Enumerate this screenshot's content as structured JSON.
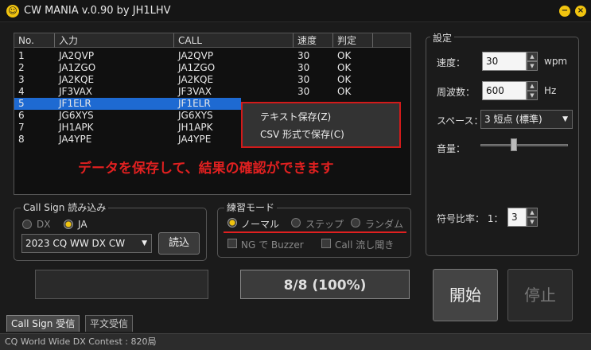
{
  "window": {
    "title": "CW MANIA v.0.90 by JH1LHV"
  },
  "list": {
    "columns": [
      "No.",
      "入力",
      "CALL",
      "速度",
      "判定"
    ],
    "rows": [
      {
        "no": "1",
        "input": "JA2QVP",
        "call": "JA2QVP",
        "speed": "30",
        "result": "OK"
      },
      {
        "no": "2",
        "input": "JA1ZGO",
        "call": "JA1ZGO",
        "speed": "30",
        "result": "OK"
      },
      {
        "no": "3",
        "input": "JA2KQE",
        "call": "JA2KQE",
        "speed": "30",
        "result": "OK"
      },
      {
        "no": "4",
        "input": "JF3VAX",
        "call": "JF3VAX",
        "speed": "30",
        "result": "OK"
      },
      {
        "no": "5",
        "input": "JF1ELR",
        "call": "JF1ELR",
        "speed": "",
        "result": ""
      },
      {
        "no": "6",
        "input": "JG6XYS",
        "call": "JG6XYS",
        "speed": "",
        "result": ""
      },
      {
        "no": "7",
        "input": "JH1APK",
        "call": "JH1APK",
        "speed": "",
        "result": ""
      },
      {
        "no": "8",
        "input": "JA4YPE",
        "call": "JA4YPE",
        "speed": "",
        "result": ""
      }
    ]
  },
  "context_menu": {
    "items": [
      "テキスト保存(Z)",
      "CSV 形式で保存(C)"
    ]
  },
  "annotation": "データを保存して、結果の確認ができます",
  "callsign": {
    "title": "Call Sign 読み込み",
    "radio": [
      "DX",
      "JA"
    ],
    "selected": "JA",
    "contest": "2023 CQ WW DX CW",
    "load_button": "読込"
  },
  "practice": {
    "title": "練習モード",
    "modes": [
      "ノーマル",
      "ステップ",
      "ランダム"
    ],
    "selected": "ノーマル",
    "checks": [
      "NG で Buzzer",
      "Call 流し聞き"
    ]
  },
  "progress": {
    "text": "8/8 (100%)",
    "fraction": 1.0
  },
  "tabs": [
    "Call Sign 受信",
    "平文受信"
  ],
  "status": "CQ World Wide DX Contest : 820局",
  "settings": {
    "title": "設定",
    "speed_label": "速度：",
    "speed_value": "30",
    "speed_unit": "wpm",
    "freq_label": "周波数：",
    "freq_value": "600",
    "freq_unit": "Hz",
    "space_label": "スペース：",
    "space_value": "3 短点 (標準)",
    "volume_label": "音量：",
    "volume_level": 0.38,
    "ratio_label": "符号比率：  1：",
    "ratio_value": "3"
  },
  "buttons": {
    "start": "開始",
    "stop": "停止"
  },
  "colors": {
    "accent": "#f1c40f",
    "selection": "#1e6ad2",
    "annotation": "#e02020"
  }
}
